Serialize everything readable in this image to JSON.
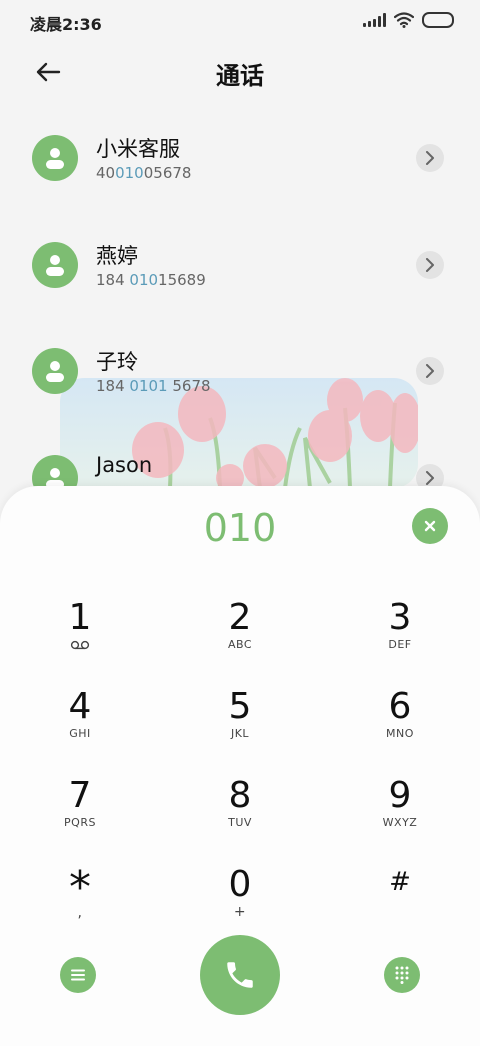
{
  "status_bar": {
    "time": "凌晨2:36"
  },
  "header": {
    "title": "通话",
    "back_icon": "arrow-left-icon"
  },
  "contacts": [
    {
      "name": "小米客服",
      "number_pre": "40",
      "number_match": "010",
      "number_post": "05678"
    },
    {
      "name": "燕婷",
      "number_pre": "184 ",
      "number_match": "010",
      "number_post": "15689"
    },
    {
      "name": "子玲",
      "number_pre": "184 ",
      "number_match": "0101",
      "number_post": " 5678"
    },
    {
      "name": "Jason",
      "number_pre": "",
      "number_match": "",
      "number_post": ""
    }
  ],
  "dialer": {
    "number": "010",
    "keys": [
      {
        "digit": "1",
        "letters": ""
      },
      {
        "digit": "2",
        "letters": "ABC"
      },
      {
        "digit": "3",
        "letters": "DEF"
      },
      {
        "digit": "4",
        "letters": "GHI"
      },
      {
        "digit": "5",
        "letters": "JKL"
      },
      {
        "digit": "6",
        "letters": "MNO"
      },
      {
        "digit": "7",
        "letters": "PQRS"
      },
      {
        "digit": "8",
        "letters": "TUV"
      },
      {
        "digit": "9",
        "letters": "WXYZ"
      },
      {
        "digit": "*",
        "letters": ","
      },
      {
        "digit": "0",
        "letters": "+"
      },
      {
        "digit": "#",
        "letters": ""
      }
    ]
  },
  "colors": {
    "accent": "#7dbd72",
    "match": "#5b9bb8",
    "background": "#f4f4f4"
  }
}
